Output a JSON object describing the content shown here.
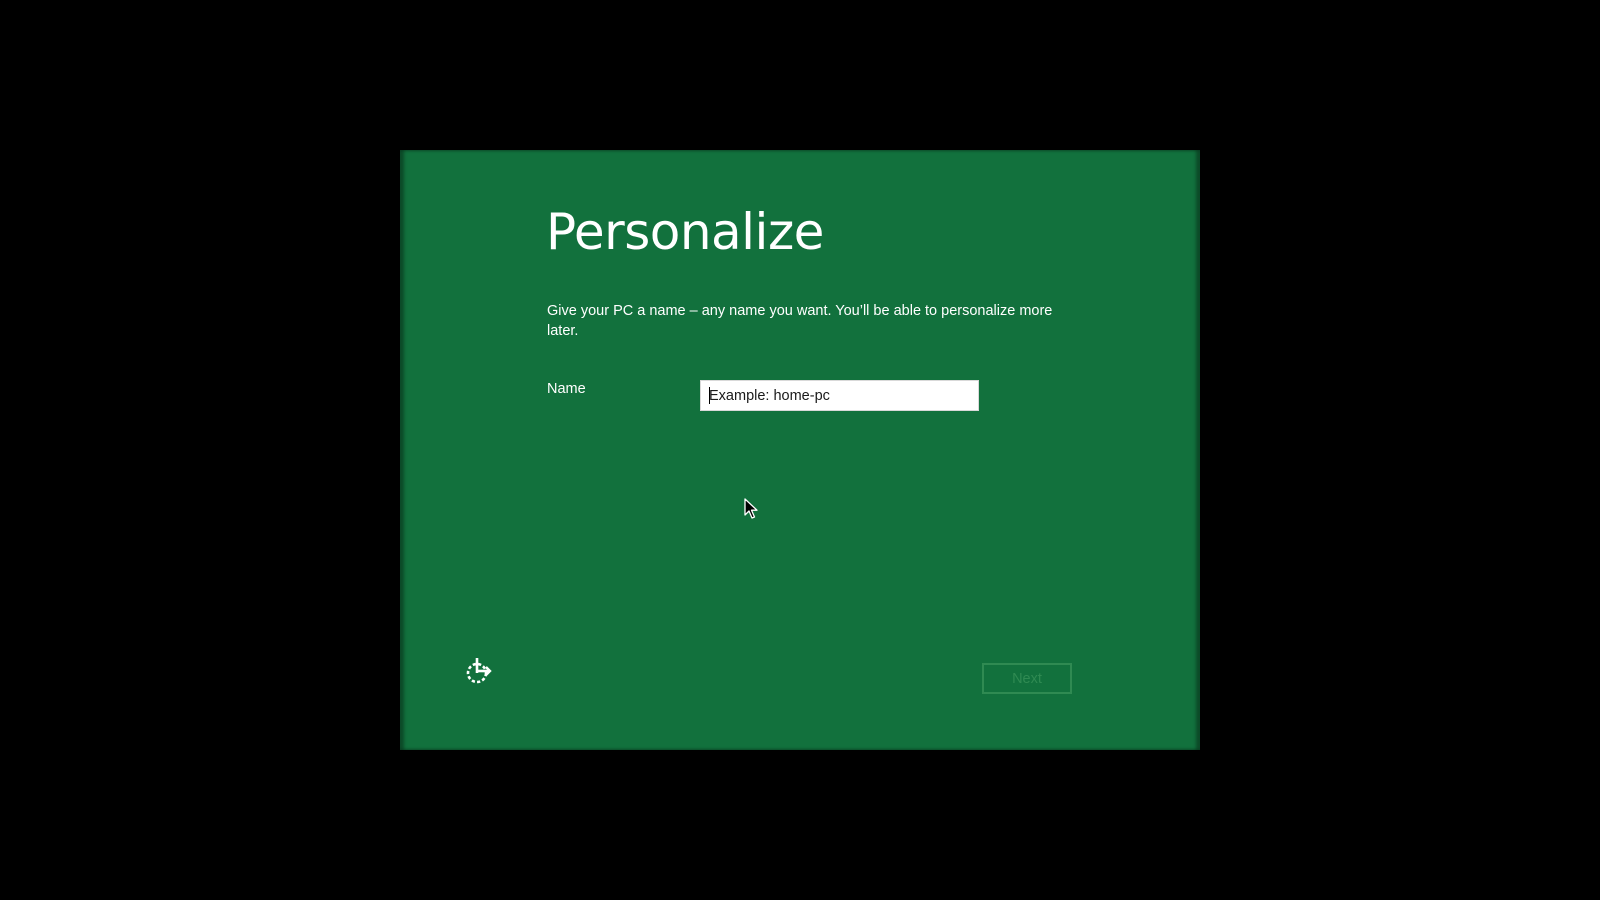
{
  "window": {
    "title": "Personalize"
  },
  "content": {
    "heading": "Personalize",
    "description": "Give your PC a name – any name you want. You’ll be able to personalize more later."
  },
  "form": {
    "name_label": "Name",
    "name_value": "",
    "name_placeholder": "Example: home-pc"
  },
  "footer": {
    "next_label": "Next",
    "next_enabled": false,
    "ease_of_access_icon": "ease-of-access-icon"
  },
  "colors": {
    "background": "#12713d",
    "outer": "#000000",
    "text": "#ffffff",
    "disabled_button": "#2f8a52"
  }
}
